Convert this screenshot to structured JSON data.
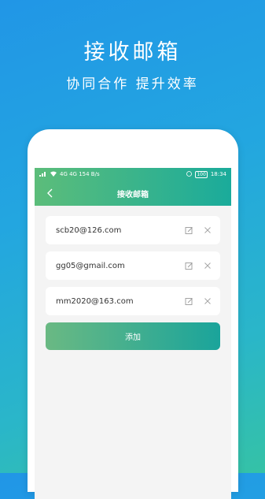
{
  "promo": {
    "title": "接收邮箱",
    "subtitle": "协同合作 提升效率"
  },
  "status_bar": {
    "left_text": "4G 4G 154 B/s",
    "time": "18:34",
    "battery": "100"
  },
  "nav": {
    "title": "接收邮箱"
  },
  "emails": [
    {
      "address": "scb20@126.com"
    },
    {
      "address": "gg05@gmail.com"
    },
    {
      "address": "mm2020@163.com"
    }
  ],
  "add_button": {
    "label": "添加"
  },
  "colors": {
    "accent_start": "#5cbd7a",
    "accent_end": "#1aab9b",
    "background_top": "#2196e6",
    "background_bottom": "#35c2a6"
  },
  "icons": [
    "back-arrow-icon",
    "edit-icon",
    "close-icon",
    "signal-icon",
    "wifi-icon",
    "alarm-icon",
    "battery-icon"
  ]
}
